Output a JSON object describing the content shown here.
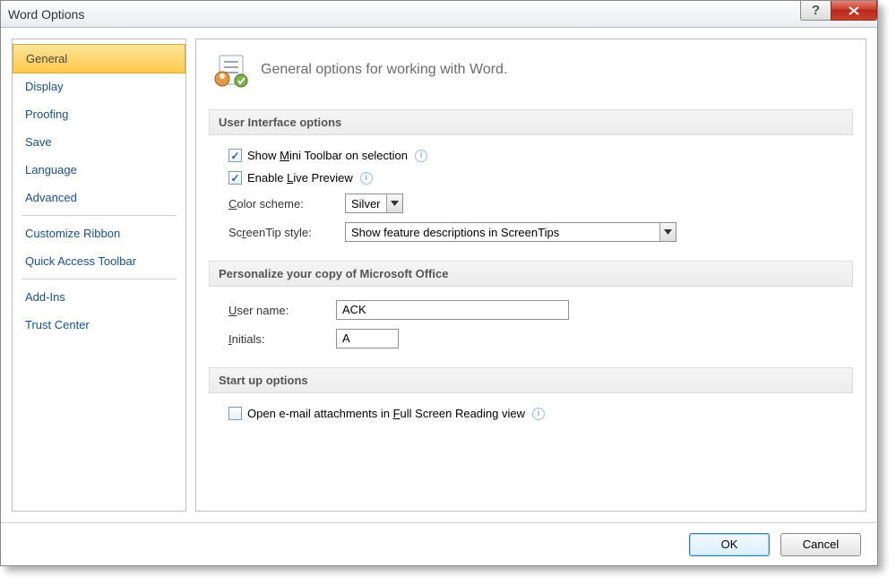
{
  "title": "Word Options",
  "sidebar": {
    "items": [
      {
        "label": "General",
        "selected": true
      },
      {
        "label": "Display"
      },
      {
        "label": "Proofing"
      },
      {
        "label": "Save"
      },
      {
        "label": "Language"
      },
      {
        "label": "Advanced"
      },
      {
        "sep": true
      },
      {
        "label": "Customize Ribbon"
      },
      {
        "label": "Quick Access Toolbar"
      },
      {
        "sep": true
      },
      {
        "label": "Add-Ins"
      },
      {
        "label": "Trust Center"
      }
    ]
  },
  "heading": "General options for working with Word.",
  "sections": {
    "ui": {
      "title": "User Interface options",
      "miniToolbar": {
        "label_pre": "Show ",
        "u": "M",
        "label_post": "ini Toolbar on selection",
        "checked": true
      },
      "livePreview": {
        "label_pre": "Enable ",
        "u": "L",
        "label_post": "ive Preview",
        "checked": true
      },
      "colorScheme": {
        "label_u": "C",
        "label_post": "olor scheme:",
        "value": "Silver"
      },
      "screenTip": {
        "label_pre": "Sc",
        "u": "r",
        "label_post": "eenTip style:",
        "value": "Show feature descriptions in ScreenTips"
      }
    },
    "personalize": {
      "title": "Personalize your copy of Microsoft Office",
      "userName": {
        "label_u": "U",
        "label_post": "ser name:",
        "value": "ACK"
      },
      "initials": {
        "label_u": "I",
        "label_post": "nitials:",
        "value": "A"
      }
    },
    "startup": {
      "title": "Start up options",
      "fullScreen": {
        "label_pre": "Open e-mail attachments in ",
        "u": "F",
        "label_post": "ull Screen Reading view",
        "checked": false
      }
    }
  },
  "footer": {
    "ok": "OK",
    "cancel": "Cancel"
  }
}
